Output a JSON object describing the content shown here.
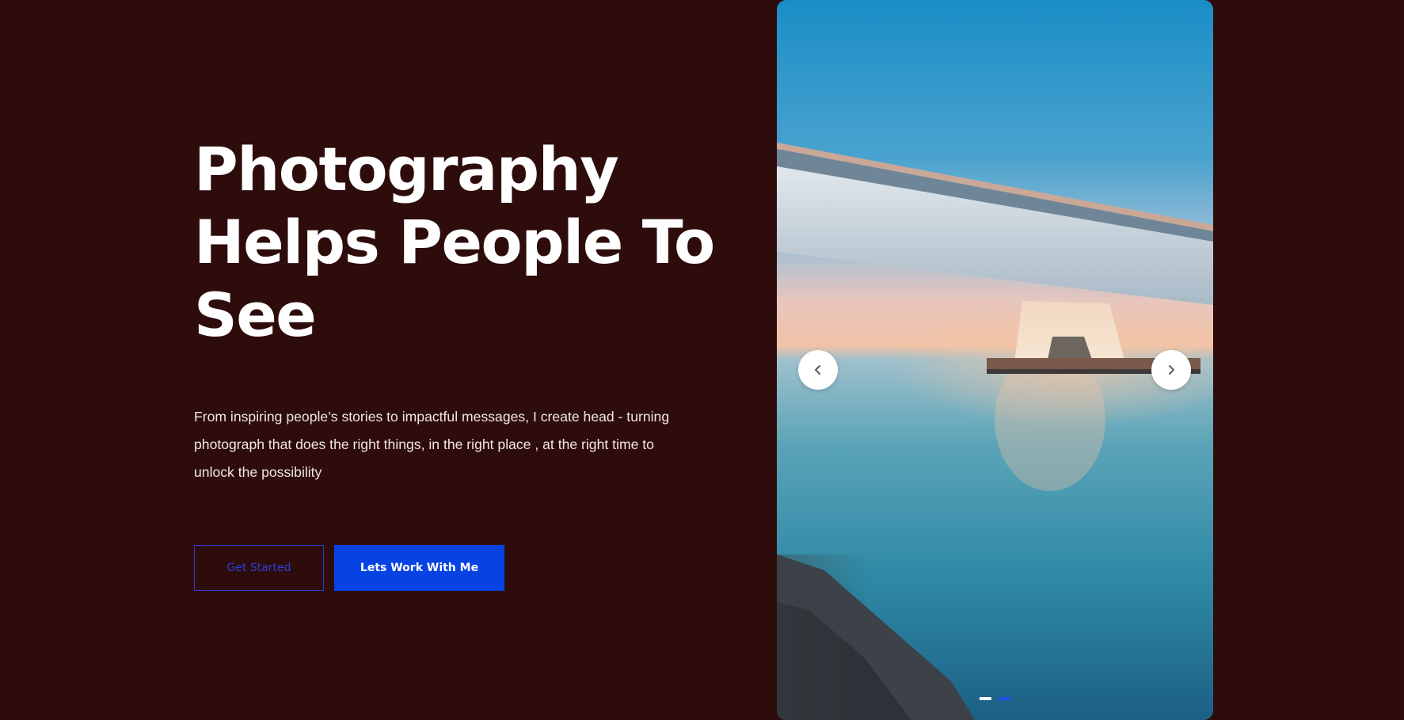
{
  "hero": {
    "title_lines": [
      "Photography",
      "Helps People To",
      "See"
    ],
    "description_lines": [
      "From inspiring people’s stories to impactful messages, I create head - turning",
      "photograph that does the right things, in the right place , at the right time to",
      "unlock the possibility"
    ]
  },
  "buttons": {
    "get_started": "Get Started",
    "work_with_me": "Lets Work With Me"
  },
  "slider": {
    "prev_icon": "chevron-left-icon",
    "next_icon": "chevron-right-icon",
    "dots": [
      {
        "active": true,
        "color": "#ffffff"
      },
      {
        "active": false,
        "color": "#1f4de8"
      }
    ]
  },
  "colors": {
    "background": "#2e0c0c",
    "accent": "#0743e3",
    "outline_button": "#2f3fc8"
  }
}
